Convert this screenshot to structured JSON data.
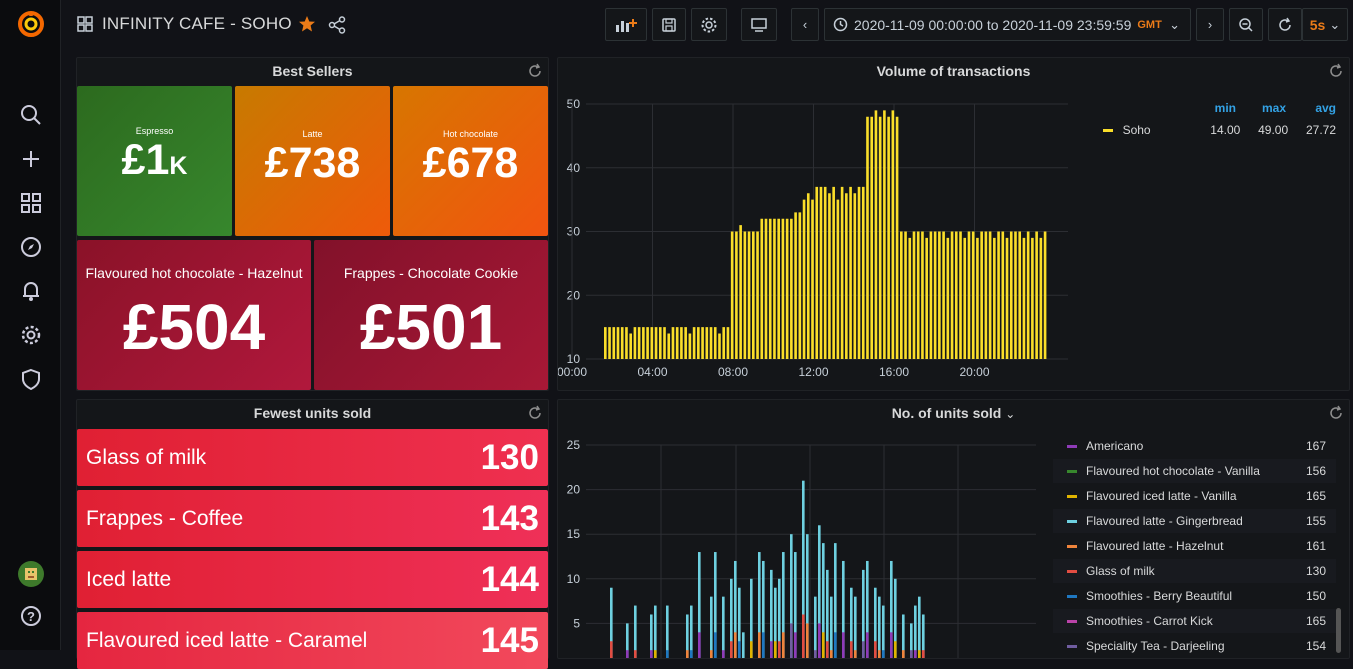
{
  "nav": {
    "items": [
      "search-icon",
      "plus-icon",
      "dashboards-icon",
      "explore-icon",
      "alerting-icon",
      "configuration-icon",
      "server-admin-icon"
    ],
    "bottom": [
      "user-avatar",
      "help-icon"
    ]
  },
  "header": {
    "title": "INFINITY CAFE - SOHO",
    "time_range": "2020-11-09 00:00:00 to 2020-11-09 23:59:59",
    "timezone": "GMT",
    "refresh": "5s"
  },
  "best_sellers": {
    "title": "Best Sellers",
    "items": [
      {
        "label": "Espresso",
        "value": "£1",
        "suffix": "K",
        "color": "#2a6d1f"
      },
      {
        "label": "Latte",
        "value": "£738",
        "color": "#e0700a"
      },
      {
        "label": "Hot chocolate",
        "value": "£678",
        "color": "#ef6a0a"
      },
      {
        "label": "Flavoured hot chocolate - Hazelnut",
        "value": "£504",
        "color": "#9d1230"
      },
      {
        "label": "Frappes - Chocolate Cookie",
        "value": "£501",
        "color": "#8f1228"
      }
    ]
  },
  "volume": {
    "title": "Volume of transactions",
    "legend_headers": [
      "min",
      "max",
      "avg"
    ],
    "legend": [
      {
        "name": "Soho",
        "min": "14.00",
        "max": "49.00",
        "avg": "27.72",
        "color": "#fade2a"
      }
    ]
  },
  "chart_data": [
    {
      "type": "bar",
      "title": "Volume of transactions",
      "x_ticks": [
        "00:00",
        "04:00",
        "08:00",
        "12:00",
        "16:00",
        "20:00"
      ],
      "y_ticks": [
        "10",
        "20",
        "30",
        "40",
        "50"
      ],
      "ylim": [
        10,
        50
      ],
      "series": [
        {
          "name": "Soho",
          "color": "#fade2a",
          "values": [
            15,
            15,
            15,
            15,
            15,
            15,
            14,
            15,
            15,
            15,
            15,
            15,
            15,
            15,
            15,
            14,
            15,
            15,
            15,
            15,
            14,
            15,
            15,
            15,
            15,
            15,
            15,
            14,
            15,
            15,
            30,
            30,
            31,
            30,
            30,
            30,
            30,
            32,
            32,
            32,
            32,
            32,
            32,
            32,
            32,
            33,
            33,
            35,
            36,
            35,
            37,
            37,
            37,
            36,
            37,
            35,
            37,
            36,
            37,
            36,
            37,
            37,
            48,
            48,
            49,
            48,
            49,
            48,
            49,
            48,
            30,
            30,
            29,
            30,
            30,
            30,
            29,
            30,
            30,
            30,
            30,
            29,
            30,
            30,
            30,
            29,
            30,
            30,
            29,
            30,
            30,
            30,
            29,
            30,
            30,
            29,
            30,
            30,
            30,
            29,
            30,
            29,
            30,
            29,
            30
          ]
        }
      ],
      "grid": true
    },
    {
      "type": "bar",
      "title": "No. of units sold",
      "y_ticks": [
        "5",
        "10",
        "15",
        "20",
        "25"
      ],
      "ylim": [
        0,
        25
      ],
      "series": [
        {
          "name": "Americano",
          "color": "#8f3bb8",
          "values": []
        },
        {
          "name": "Flavoured iced latte",
          "color": "#6ed0e0",
          "values": [
            0,
            0,
            9,
            0,
            0,
            0,
            5,
            0,
            7,
            0,
            0,
            0,
            6,
            7,
            0,
            0,
            7,
            0,
            0,
            0,
            0,
            6,
            7,
            0,
            13,
            0,
            0,
            8,
            13,
            0,
            8,
            0,
            10,
            12,
            9,
            4,
            0,
            10,
            0,
            13,
            12,
            0,
            11,
            9,
            10,
            13,
            0,
            15,
            13,
            0,
            21,
            15,
            0,
            8,
            16,
            14,
            11,
            8,
            14,
            0,
            12,
            0,
            9,
            8,
            0,
            11,
            12,
            0,
            9,
            8,
            7,
            0,
            12,
            10,
            0,
            6,
            0,
            5,
            7,
            8,
            6,
            0,
            0,
            0,
            0,
            0,
            0,
            0,
            0,
            0,
            0,
            0,
            0,
            0,
            0,
            0,
            0,
            0,
            0,
            0,
            0,
            0,
            0,
            0,
            0
          ]
        }
      ],
      "grid": true
    }
  ],
  "fewest": {
    "title": "Fewest units sold",
    "items": [
      {
        "label": "Glass of milk",
        "value": "130",
        "color": "#e02f44"
      },
      {
        "label": "Frappes - Coffee",
        "value": "143",
        "color": "#e02f44"
      },
      {
        "label": "Iced latte",
        "value": "144",
        "color": "#e02f44"
      },
      {
        "label": "Flavoured iced latte - Caramel",
        "value": "145",
        "color": "#f2495c"
      }
    ]
  },
  "units": {
    "title": "No. of units sold",
    "legend": [
      {
        "name": "Americano",
        "value": "167",
        "color": "#8f3bb8"
      },
      {
        "name": "Flavoured hot chocolate - Vanilla",
        "value": "156",
        "color": "#37872d"
      },
      {
        "name": "Flavoured iced latte - Vanilla",
        "value": "165",
        "color": "#e0b400"
      },
      {
        "name": "Flavoured latte - Gingerbread",
        "value": "155",
        "color": "#6ed0e0"
      },
      {
        "name": "Flavoured latte - Hazelnut",
        "value": "161",
        "color": "#ef843c"
      },
      {
        "name": "Glass of milk",
        "value": "130",
        "color": "#e24d42"
      },
      {
        "name": "Smoothies - Berry Beautiful",
        "value": "150",
        "color": "#1f78c1"
      },
      {
        "name": "Smoothies - Carrot Kick",
        "value": "165",
        "color": "#ba43a9"
      },
      {
        "name": "Speciality Tea - Darjeeling",
        "value": "154",
        "color": "#705da0"
      }
    ]
  }
}
